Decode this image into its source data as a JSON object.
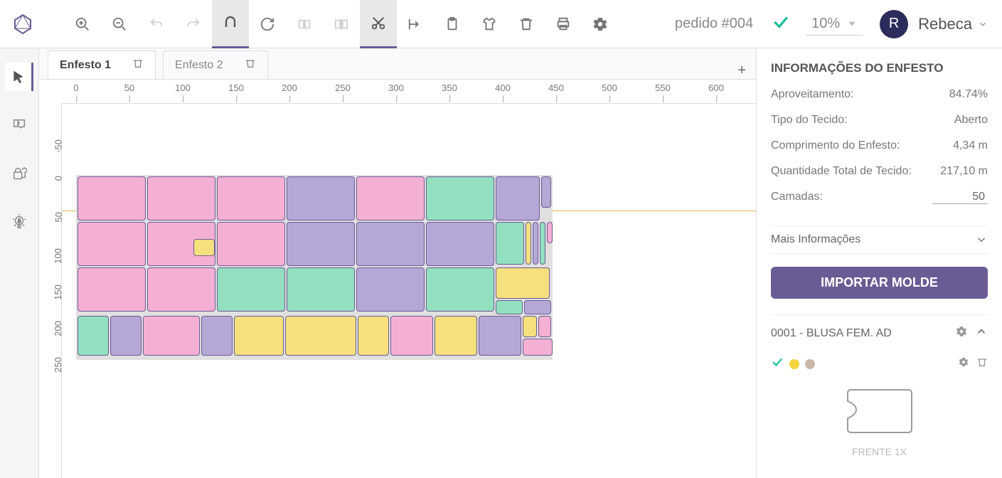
{
  "header": {
    "order_label": "pedido #004",
    "zoom": "10%",
    "user_initial": "R",
    "user_name": "Rebeca"
  },
  "tabs": [
    {
      "label": "Enfesto 1",
      "active": true
    },
    {
      "label": "Enfesto 2",
      "active": false
    }
  ],
  "ruler_h": [
    0,
    50,
    100,
    150,
    200,
    250,
    300,
    350,
    400,
    450,
    500,
    550,
    600
  ],
  "ruler_v": [
    -50,
    0,
    50,
    100,
    150,
    200,
    250
  ],
  "panel": {
    "title": "INFORMAÇÕES DO ENFESTO",
    "aproveitamento_label": "Aproveitamento:",
    "aproveitamento_value": "84.74%",
    "tipo_label": "Tipo do Tecido:",
    "tipo_value": "Aberto",
    "comprimento_label": "Comprimento do Enfesto:",
    "comprimento_value": "4,34 m",
    "quantidade_label": "Quantidade Total de Tecido:",
    "quantidade_value": "217,10 m",
    "camadas_label": "Camadas:",
    "camadas_value": "50",
    "more_info": "Mais Informações",
    "import_btn": "IMPORTAR MOLDE",
    "mold_name": "0001 - BLUSA FEM. AD",
    "mold_piece": "FRENTE 1X"
  }
}
